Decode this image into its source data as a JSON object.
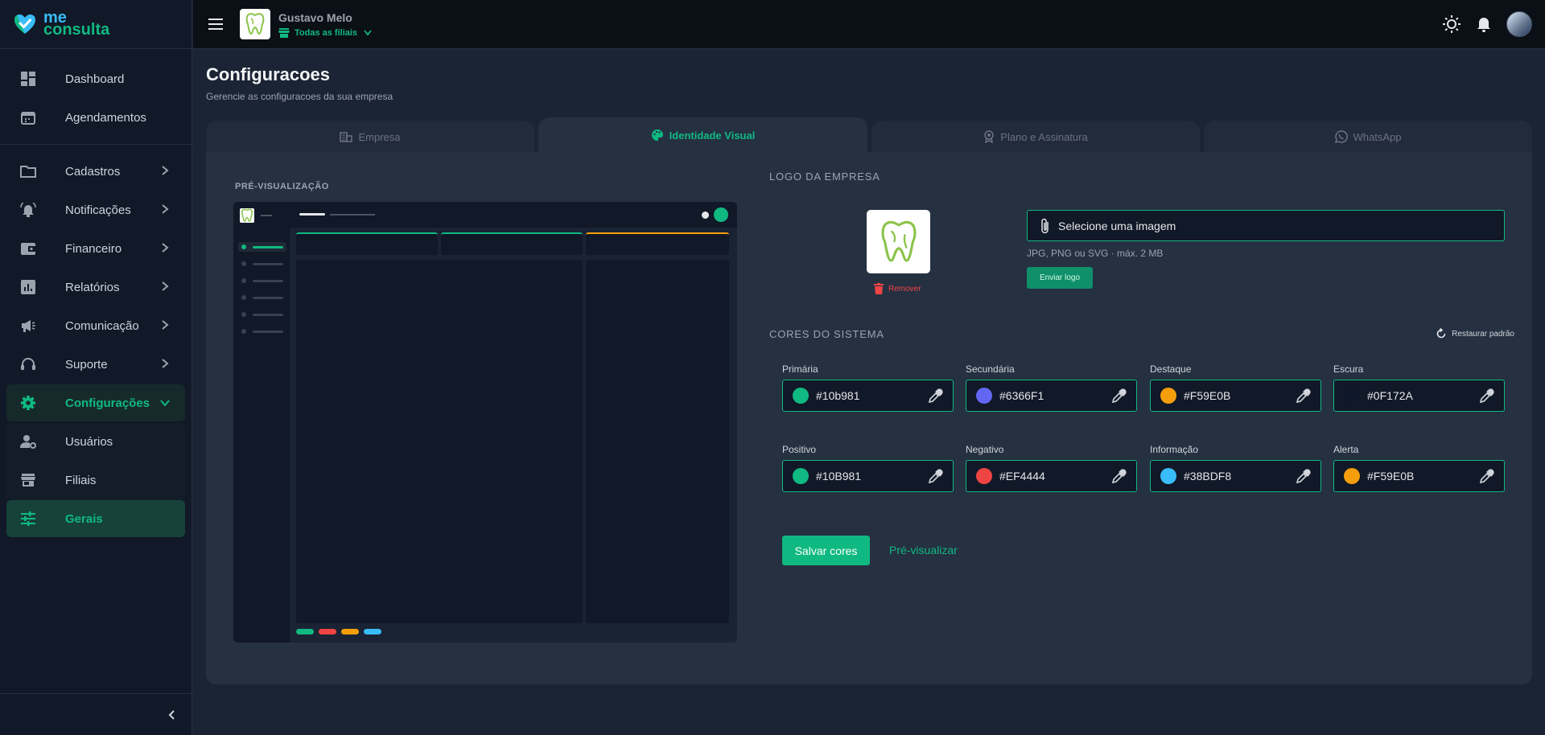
{
  "brand": {
    "line1": "me",
    "line2": "consulta"
  },
  "sidebar": {
    "items": [
      {
        "label": "Dashboard"
      },
      {
        "label": "Agendamentos"
      },
      {
        "label": "Cadastros"
      },
      {
        "label": "Notificações"
      },
      {
        "label": "Financeiro"
      },
      {
        "label": "Relatórios"
      },
      {
        "label": "Comunicação"
      },
      {
        "label": "Suporte"
      },
      {
        "label": "Configurações"
      },
      {
        "label": "Usuários"
      },
      {
        "label": "Filiais"
      },
      {
        "label": "Gerais"
      }
    ]
  },
  "header": {
    "company_name": "Gustavo Melo",
    "branch": "Todas as filiais"
  },
  "page": {
    "title": "Configuracoes",
    "subtitle": "Gerencie as configuracoes da sua empresa"
  },
  "tabs": [
    {
      "label": "Empresa"
    },
    {
      "label": "Identidade Visual"
    },
    {
      "label": "Plano e Assinatura"
    },
    {
      "label": "WhatsApp"
    }
  ],
  "preview": {
    "label": "PRÉ-VISUALIZAÇÃO"
  },
  "logo_section": {
    "title": "LOGO DA EMPRESA",
    "remove": "Remover",
    "file_placeholder": "Selecione uma imagem",
    "hint": "JPG, PNG ou SVG · máx. 2 MB",
    "upload": "Enviar logo"
  },
  "colors_section": {
    "title": "CORES DO SISTEMA",
    "restore": "Restaurar padrão",
    "fields": [
      {
        "label": "Primária",
        "value": "#10b981",
        "swatch": "#10b981"
      },
      {
        "label": "Secundária",
        "value": "#6366F1",
        "swatch": "#6366F1"
      },
      {
        "label": "Destaque",
        "value": "#F59E0B",
        "swatch": "#F59E0B"
      },
      {
        "label": "Escura",
        "value": "#0F172A",
        "swatch": "#0F172A"
      },
      {
        "label": "Positivo",
        "value": "#10B981",
        "swatch": "#10B981"
      },
      {
        "label": "Negativo",
        "value": "#EF4444",
        "swatch": "#EF4444"
      },
      {
        "label": "Informação",
        "value": "#38BDF8",
        "swatch": "#38BDF8"
      },
      {
        "label": "Alerta",
        "value": "#F59E0B",
        "swatch": "#F59E0B"
      }
    ],
    "save": "Salvar cores",
    "preview": "Pré-visualizar"
  },
  "theme": {
    "accent": "#10b981",
    "danger": "#ef4444",
    "background": "#1b2434"
  }
}
